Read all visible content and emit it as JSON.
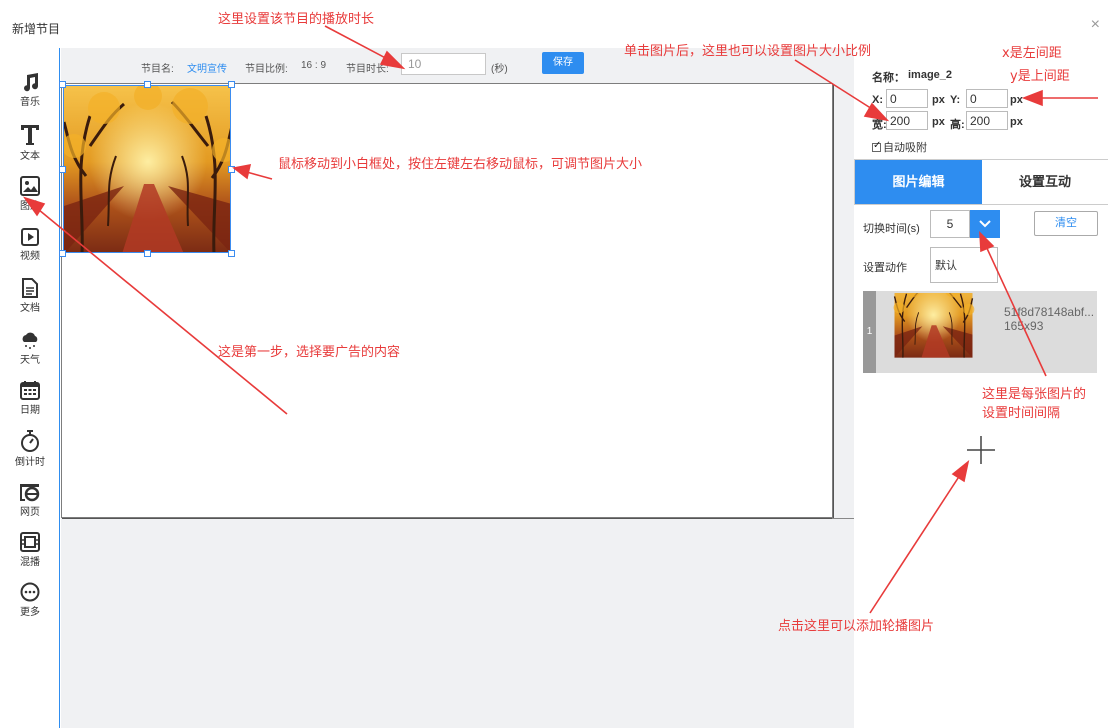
{
  "dialog": {
    "title": "新增节目",
    "close": "×"
  },
  "left_toolbar": {
    "items": [
      {
        "label": "音乐",
        "icon": "music-note-icon"
      },
      {
        "label": "文本",
        "icon": "text-t-icon"
      },
      {
        "label": "图片",
        "icon": "image-icon"
      },
      {
        "label": "视频",
        "icon": "play-icon"
      },
      {
        "label": "文档",
        "icon": "document-icon"
      },
      {
        "label": "天气",
        "icon": "weather-cloud-icon"
      },
      {
        "label": "日期",
        "icon": "calendar-icon"
      },
      {
        "label": "倒计时",
        "icon": "stopwatch-icon"
      },
      {
        "label": "网页",
        "icon": "browser-e-icon"
      },
      {
        "label": "混播",
        "icon": "mix-icon"
      },
      {
        "label": "更多",
        "icon": "more-dots-icon"
      }
    ]
  },
  "program_bar": {
    "name_label": "节目名:",
    "name_value": "文明宣传",
    "ratio_label": "节目比例:",
    "ratio_value": "16 : 9",
    "duration_label": "节目时长:",
    "duration_value": "10",
    "duration_unit": "(秒)",
    "save_label": "保存"
  },
  "properties": {
    "name_label": "名称：",
    "name_value": "image_2",
    "x_label": "X:",
    "x_value": "0",
    "y_label": "Y:",
    "y_value": "0",
    "width_label": "宽:",
    "width_value": "200",
    "height_label": "高:",
    "height_value": "200",
    "unit": "px",
    "auto_snap_label": "自动吸附",
    "auto_snap_checked": true
  },
  "tabs": {
    "image_edit": "图片编辑",
    "interaction": "设置互动"
  },
  "image_edit": {
    "switch_time_label": "切换时间(s)",
    "switch_time_value": "5",
    "clear_label": "清空",
    "action_label": "设置动作",
    "action_value": "默认",
    "thumbnails": [
      {
        "index": "1",
        "name": "51f8d78148abf...",
        "size": "165x93"
      }
    ]
  },
  "annotations": {
    "duration": "这里设置该节目的播放时长",
    "size_ratio": "单击图片后，这里也可以设置图片大小比例",
    "x_note": "x是左间距",
    "y_note": "y是上间距",
    "resize": "鼠标移动到小白框处，按住左键左右移动鼠标，可调节图片大小",
    "step_one": "这是第一步，选择要广告的内容",
    "interval_line1": "这里是每张图片的",
    "interval_line2": "设置时间间隔",
    "add_carousel": "点击这里可以添加轮播图片"
  },
  "colors": {
    "accent": "#2e8df0",
    "annotation": "#e83b3b",
    "canvas_bg": "#f0f1f3"
  }
}
